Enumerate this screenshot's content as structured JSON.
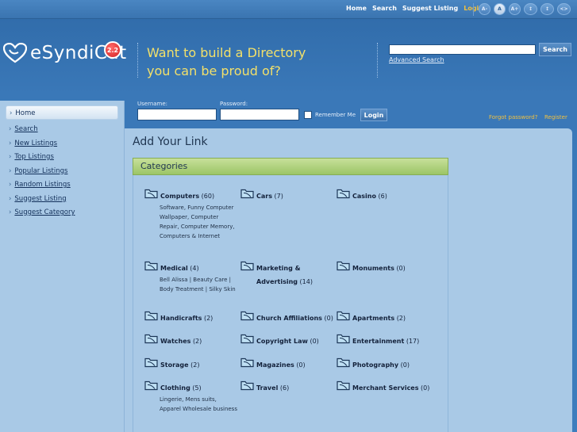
{
  "topnav": {
    "links": [
      "Home",
      "Search",
      "Suggest Listing",
      "Login"
    ],
    "controls": [
      "A-",
      "A",
      "A+",
      "↕",
      "↕",
      "<>"
    ]
  },
  "header": {
    "logo_text": "eSyndiCat",
    "version": "2.2",
    "tagline_line1": "Want to build a Directory",
    "tagline_line2": "you can be proud of?",
    "search_placeholder": "",
    "search_button": "Search",
    "advanced_search": "Advanced Search"
  },
  "sidebar": {
    "items": [
      "Home",
      "Search",
      "New Listings",
      "Top Listings",
      "Popular Listings",
      "Random Listings",
      "Suggest Listing",
      "Suggest Category"
    ]
  },
  "login": {
    "username_label": "Username:",
    "password_label": "Password:",
    "remember_label": "Remember Me",
    "login_button": "Login",
    "forgot_password": "Forgot password?",
    "register": "Register"
  },
  "main": {
    "title": "Add Your Link",
    "categories_header": "Categories",
    "categories": [
      {
        "name": "Computers",
        "count": "(60)",
        "subs": "Software, Funny Computer Wallpaper, Computer Repair, Computer Memory, Computers & Internet"
      },
      {
        "name": "Cars",
        "count": "(7)",
        "subs": ""
      },
      {
        "name": "Casino",
        "count": "(6)",
        "subs": ""
      },
      {
        "name": "Medical",
        "count": "(4)",
        "subs": "Bell Alissa | Beauty Care | Body Treatment | Silky Skin"
      },
      {
        "name": "Marketing & Advertising",
        "count": "(14)",
        "subs": ""
      },
      {
        "name": "Monuments",
        "count": "(0)",
        "subs": ""
      },
      {
        "name": "Handicrafts",
        "count": "(2)",
        "subs": ""
      },
      {
        "name": "Church Affiliations",
        "count": "(0)",
        "subs": ""
      },
      {
        "name": "Apartments",
        "count": "(2)",
        "subs": ""
      },
      {
        "name": "Watches",
        "count": "(2)",
        "subs": ""
      },
      {
        "name": "Copyright Law",
        "count": "(0)",
        "subs": ""
      },
      {
        "name": "Entertainment",
        "count": "(17)",
        "subs": ""
      },
      {
        "name": "Storage",
        "count": "(2)",
        "subs": ""
      },
      {
        "name": "Magazines",
        "count": "(0)",
        "subs": ""
      },
      {
        "name": "Photography",
        "count": "(0)",
        "subs": ""
      },
      {
        "name": "Clothing",
        "count": "(5)",
        "subs": "Lingerie, Mens suits, Apparel Wholesale business"
      },
      {
        "name": "Travel",
        "count": "(6)",
        "subs": ""
      },
      {
        "name": "Merchant Services",
        "count": "(0)",
        "subs": ""
      }
    ]
  }
}
